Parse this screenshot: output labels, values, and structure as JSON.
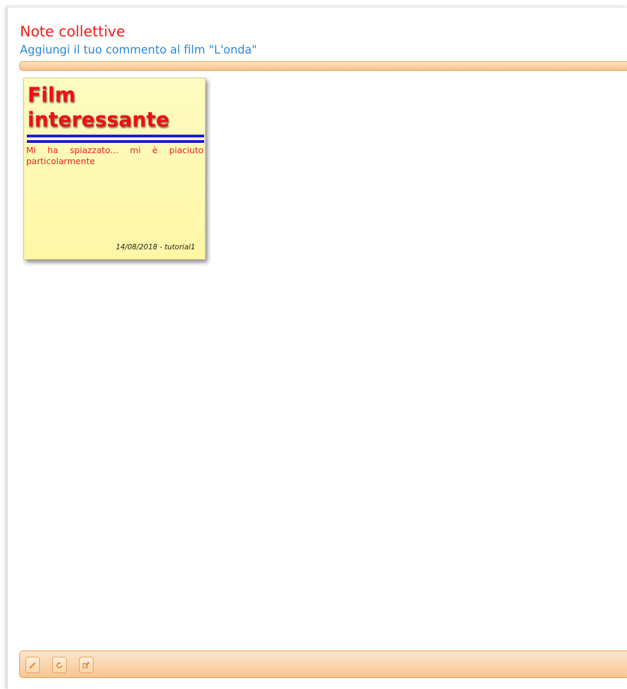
{
  "page": {
    "title": "Note collettive",
    "subtitle": "Aggiungi il tuo commento al film \"L'onda\""
  },
  "note": {
    "title": "Film interessante",
    "body": "Mi ha spiazzato... mi è piaciuto particolarmente",
    "footer": "14/08/2018 - tutorial1",
    "background_color": "#fdf9b0",
    "title_color": "#ee1111",
    "rule_color": "#1a1ad6"
  },
  "toolbar": {
    "buttons": [
      {
        "name": "edit",
        "icon": "pencil-icon"
      },
      {
        "name": "refresh",
        "icon": "refresh-icon"
      },
      {
        "name": "open-external",
        "icon": "external-link-icon"
      }
    ]
  },
  "colors": {
    "title": "#ee1c1c",
    "subtitle": "#2a86e0",
    "bar_accent": "#f8c28c",
    "bar_border": "#e89b52"
  }
}
